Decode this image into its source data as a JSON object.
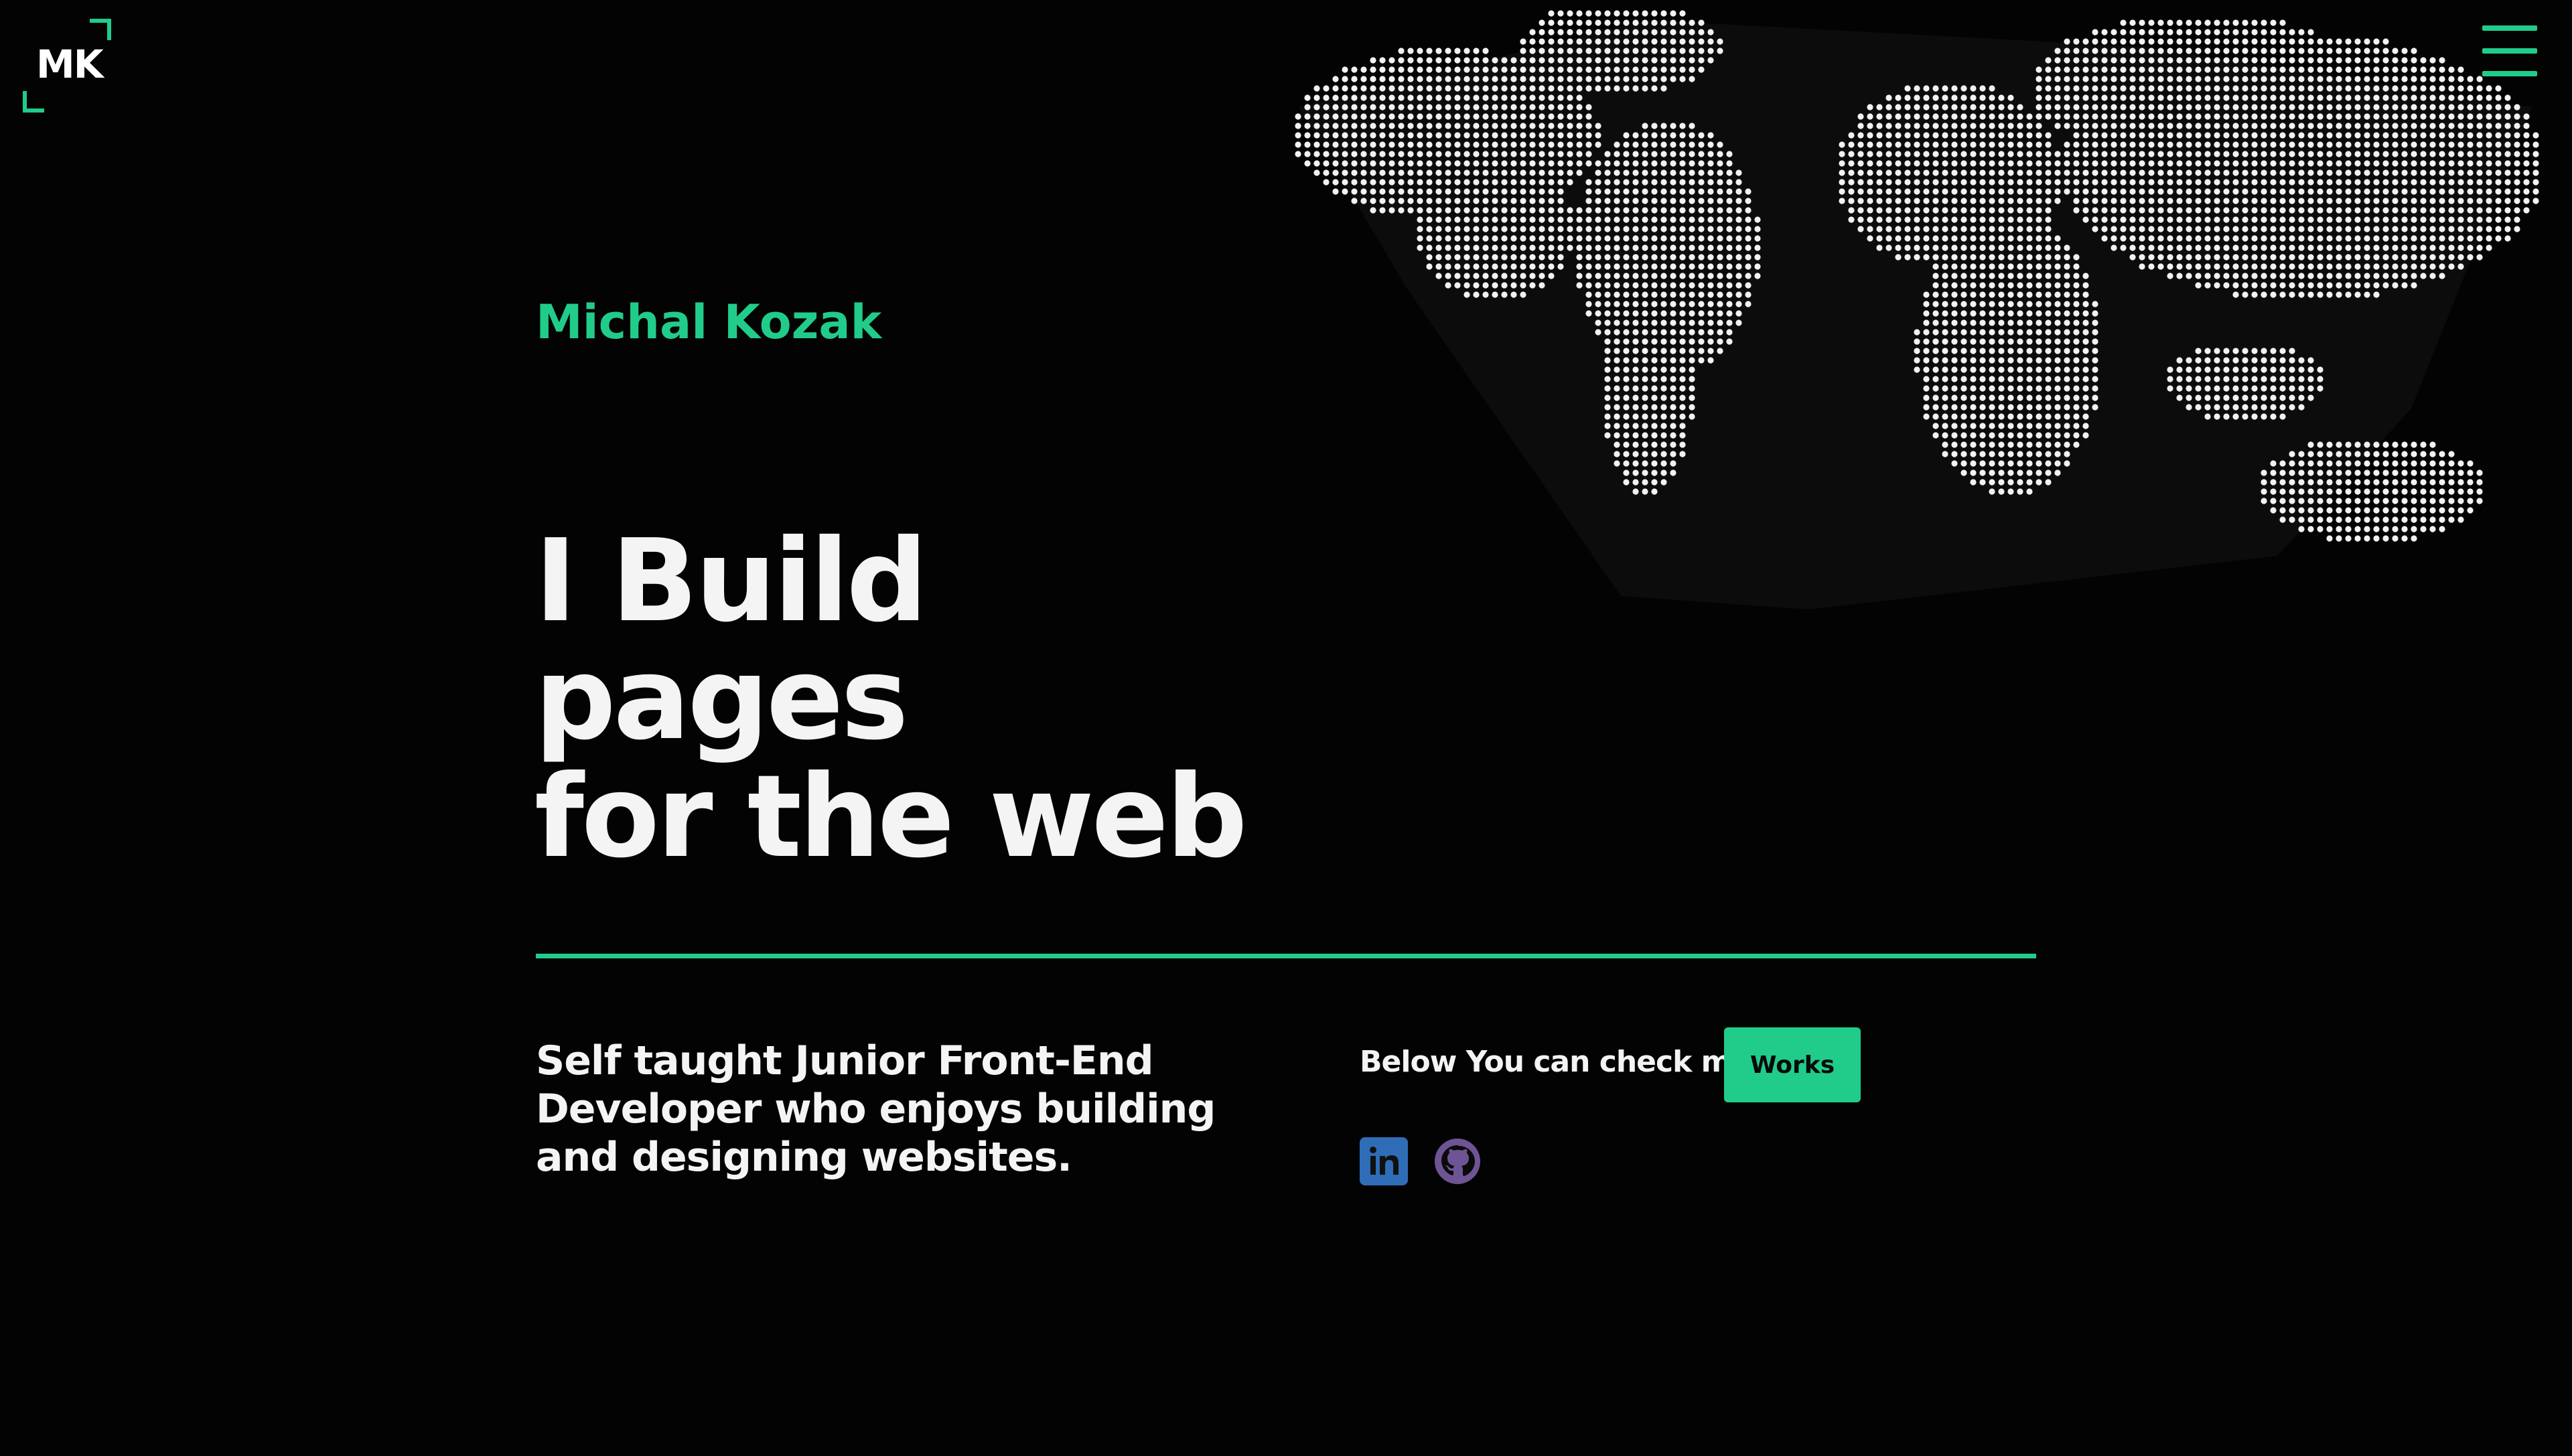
{
  "header": {
    "logo_text": "MK",
    "menu_icon": "hamburger-menu-icon"
  },
  "hero": {
    "name": "Michal Kozak",
    "headline": [
      "I Build",
      "pages",
      "for the web"
    ],
    "tagline": "Self taught Junior Front-End Developer who enjoys building and designing websites."
  },
  "cta": {
    "text": "Below You can check my",
    "button_label": "Works"
  },
  "social": {
    "linkedin_icon": "linkedin-icon",
    "github_icon": "github-icon"
  },
  "colors": {
    "background": "#030303",
    "accent": "#21cc8b",
    "text": "#f4f4f4",
    "linkedin": "#2f6db8",
    "github": "#6e5494"
  },
  "decoration": {
    "map_icon": "dotted-world-map"
  }
}
